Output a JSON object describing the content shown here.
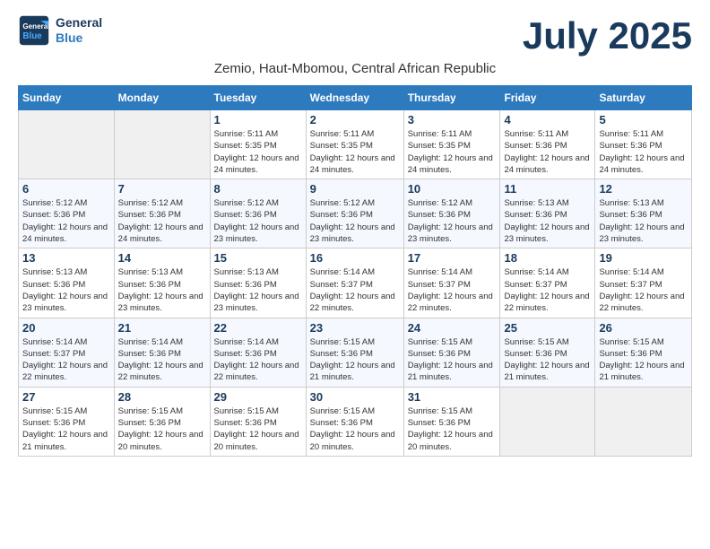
{
  "logo": {
    "line1": "General",
    "line2": "Blue"
  },
  "title": "July 2025",
  "subtitle": "Zemio, Haut-Mbomou, Central African Republic",
  "days_of_week": [
    "Sunday",
    "Monday",
    "Tuesday",
    "Wednesday",
    "Thursday",
    "Friday",
    "Saturday"
  ],
  "weeks": [
    [
      {
        "day": "",
        "info": ""
      },
      {
        "day": "",
        "info": ""
      },
      {
        "day": "1",
        "sunrise": "5:11 AM",
        "sunset": "5:35 PM",
        "daylight": "12 hours and 24 minutes."
      },
      {
        "day": "2",
        "sunrise": "5:11 AM",
        "sunset": "5:35 PM",
        "daylight": "12 hours and 24 minutes."
      },
      {
        "day": "3",
        "sunrise": "5:11 AM",
        "sunset": "5:35 PM",
        "daylight": "12 hours and 24 minutes."
      },
      {
        "day": "4",
        "sunrise": "5:11 AM",
        "sunset": "5:36 PM",
        "daylight": "12 hours and 24 minutes."
      },
      {
        "day": "5",
        "sunrise": "5:11 AM",
        "sunset": "5:36 PM",
        "daylight": "12 hours and 24 minutes."
      }
    ],
    [
      {
        "day": "6",
        "sunrise": "5:12 AM",
        "sunset": "5:36 PM",
        "daylight": "12 hours and 24 minutes."
      },
      {
        "day": "7",
        "sunrise": "5:12 AM",
        "sunset": "5:36 PM",
        "daylight": "12 hours and 24 minutes."
      },
      {
        "day": "8",
        "sunrise": "5:12 AM",
        "sunset": "5:36 PM",
        "daylight": "12 hours and 23 minutes."
      },
      {
        "day": "9",
        "sunrise": "5:12 AM",
        "sunset": "5:36 PM",
        "daylight": "12 hours and 23 minutes."
      },
      {
        "day": "10",
        "sunrise": "5:12 AM",
        "sunset": "5:36 PM",
        "daylight": "12 hours and 23 minutes."
      },
      {
        "day": "11",
        "sunrise": "5:13 AM",
        "sunset": "5:36 PM",
        "daylight": "12 hours and 23 minutes."
      },
      {
        "day": "12",
        "sunrise": "5:13 AM",
        "sunset": "5:36 PM",
        "daylight": "12 hours and 23 minutes."
      }
    ],
    [
      {
        "day": "13",
        "sunrise": "5:13 AM",
        "sunset": "5:36 PM",
        "daylight": "12 hours and 23 minutes."
      },
      {
        "day": "14",
        "sunrise": "5:13 AM",
        "sunset": "5:36 PM",
        "daylight": "12 hours and 23 minutes."
      },
      {
        "day": "15",
        "sunrise": "5:13 AM",
        "sunset": "5:36 PM",
        "daylight": "12 hours and 23 minutes."
      },
      {
        "day": "16",
        "sunrise": "5:14 AM",
        "sunset": "5:37 PM",
        "daylight": "12 hours and 22 minutes."
      },
      {
        "day": "17",
        "sunrise": "5:14 AM",
        "sunset": "5:37 PM",
        "daylight": "12 hours and 22 minutes."
      },
      {
        "day": "18",
        "sunrise": "5:14 AM",
        "sunset": "5:37 PM",
        "daylight": "12 hours and 22 minutes."
      },
      {
        "day": "19",
        "sunrise": "5:14 AM",
        "sunset": "5:37 PM",
        "daylight": "12 hours and 22 minutes."
      }
    ],
    [
      {
        "day": "20",
        "sunrise": "5:14 AM",
        "sunset": "5:37 PM",
        "daylight": "12 hours and 22 minutes."
      },
      {
        "day": "21",
        "sunrise": "5:14 AM",
        "sunset": "5:36 PM",
        "daylight": "12 hours and 22 minutes."
      },
      {
        "day": "22",
        "sunrise": "5:14 AM",
        "sunset": "5:36 PM",
        "daylight": "12 hours and 22 minutes."
      },
      {
        "day": "23",
        "sunrise": "5:15 AM",
        "sunset": "5:36 PM",
        "daylight": "12 hours and 21 minutes."
      },
      {
        "day": "24",
        "sunrise": "5:15 AM",
        "sunset": "5:36 PM",
        "daylight": "12 hours and 21 minutes."
      },
      {
        "day": "25",
        "sunrise": "5:15 AM",
        "sunset": "5:36 PM",
        "daylight": "12 hours and 21 minutes."
      },
      {
        "day": "26",
        "sunrise": "5:15 AM",
        "sunset": "5:36 PM",
        "daylight": "12 hours and 21 minutes."
      }
    ],
    [
      {
        "day": "27",
        "sunrise": "5:15 AM",
        "sunset": "5:36 PM",
        "daylight": "12 hours and 21 minutes."
      },
      {
        "day": "28",
        "sunrise": "5:15 AM",
        "sunset": "5:36 PM",
        "daylight": "12 hours and 20 minutes."
      },
      {
        "day": "29",
        "sunrise": "5:15 AM",
        "sunset": "5:36 PM",
        "daylight": "12 hours and 20 minutes."
      },
      {
        "day": "30",
        "sunrise": "5:15 AM",
        "sunset": "5:36 PM",
        "daylight": "12 hours and 20 minutes."
      },
      {
        "day": "31",
        "sunrise": "5:15 AM",
        "sunset": "5:36 PM",
        "daylight": "12 hours and 20 minutes."
      },
      {
        "day": "",
        "info": ""
      },
      {
        "day": "",
        "info": ""
      }
    ]
  ],
  "labels": {
    "sunrise_prefix": "Sunrise: ",
    "sunset_prefix": "Sunset: ",
    "daylight_prefix": "Daylight: "
  }
}
